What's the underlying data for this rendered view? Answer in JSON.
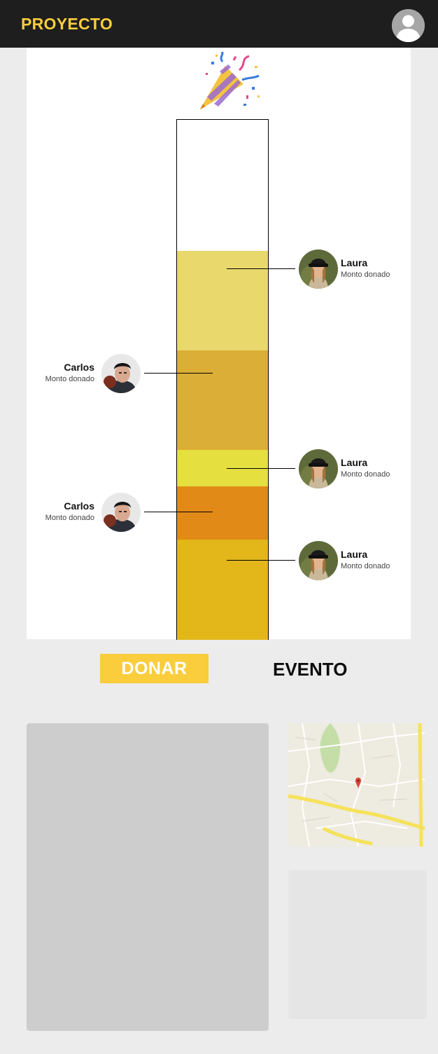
{
  "header": {
    "brand": "PROYECTO",
    "profile_icon": "user-avatar-icon"
  },
  "celebration_icon": "party-popper-icon",
  "donations": [
    {
      "name": "Carlos",
      "subtitle": "Monto donado",
      "side": "left"
    },
    {
      "name": "Carlos",
      "subtitle": "Monto donado",
      "side": "left"
    },
    {
      "name": "Laura",
      "subtitle": "Monto donado",
      "side": "right"
    },
    {
      "name": "Laura",
      "subtitle": "Monto donado",
      "side": "right"
    },
    {
      "name": "Laura",
      "subtitle": "Monto donado",
      "side": "right"
    }
  ],
  "progress": {
    "filled_fraction": 0.75,
    "segment_colors": [
      "#e9d96d",
      "#dbae37",
      "#e5e040",
      "#e28a17",
      "#e3b719"
    ]
  },
  "actions": {
    "donate_label": "DONAR",
    "event_label": "EVENTO"
  },
  "colors": {
    "brand": "#f9cd3c",
    "topbar": "#1e1e1e",
    "page_background": "#ececec"
  }
}
